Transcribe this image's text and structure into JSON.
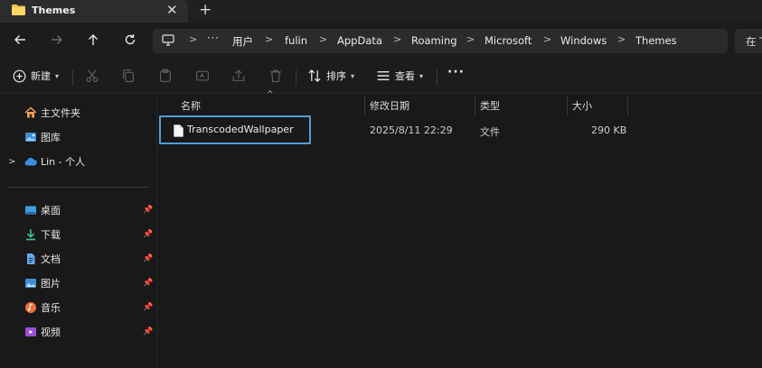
{
  "tab": {
    "title": "Themes",
    "close_glyph": "✕",
    "new_tab_glyph": "+"
  },
  "nav": {
    "back_icon": "arrow-left-icon",
    "forward_icon": "arrow-right-icon",
    "up_icon": "arrow-up-icon",
    "refresh_icon": "refresh-icon",
    "more_glyph": "···",
    "breadcrumbs": [
      "用户",
      "fulin",
      "AppData",
      "Roaming",
      "Microsoft",
      "Windows",
      "Themes"
    ],
    "search_partial": "在 T"
  },
  "commands": {
    "new_label": "新建",
    "sort_label": "排序",
    "view_label": "查看",
    "more_glyph": "···"
  },
  "sidebar": {
    "home": "主文件夹",
    "gallery": "图库",
    "onedrive": "Lin - 个人",
    "pinned": [
      "桌面",
      "下载",
      "文档",
      "图片",
      "音乐",
      "视频"
    ]
  },
  "columns": {
    "name": "名称",
    "modified": "修改日期",
    "type": "类型",
    "size": "大小"
  },
  "files": [
    {
      "name": "TranscodedWallpaper",
      "modified": "2025/8/11 22:29",
      "type": "文件",
      "size": "290 KB"
    }
  ],
  "colors": {
    "selection_outline": "#4e9ed6",
    "folder": "#f2c14e",
    "background": "#191919"
  }
}
